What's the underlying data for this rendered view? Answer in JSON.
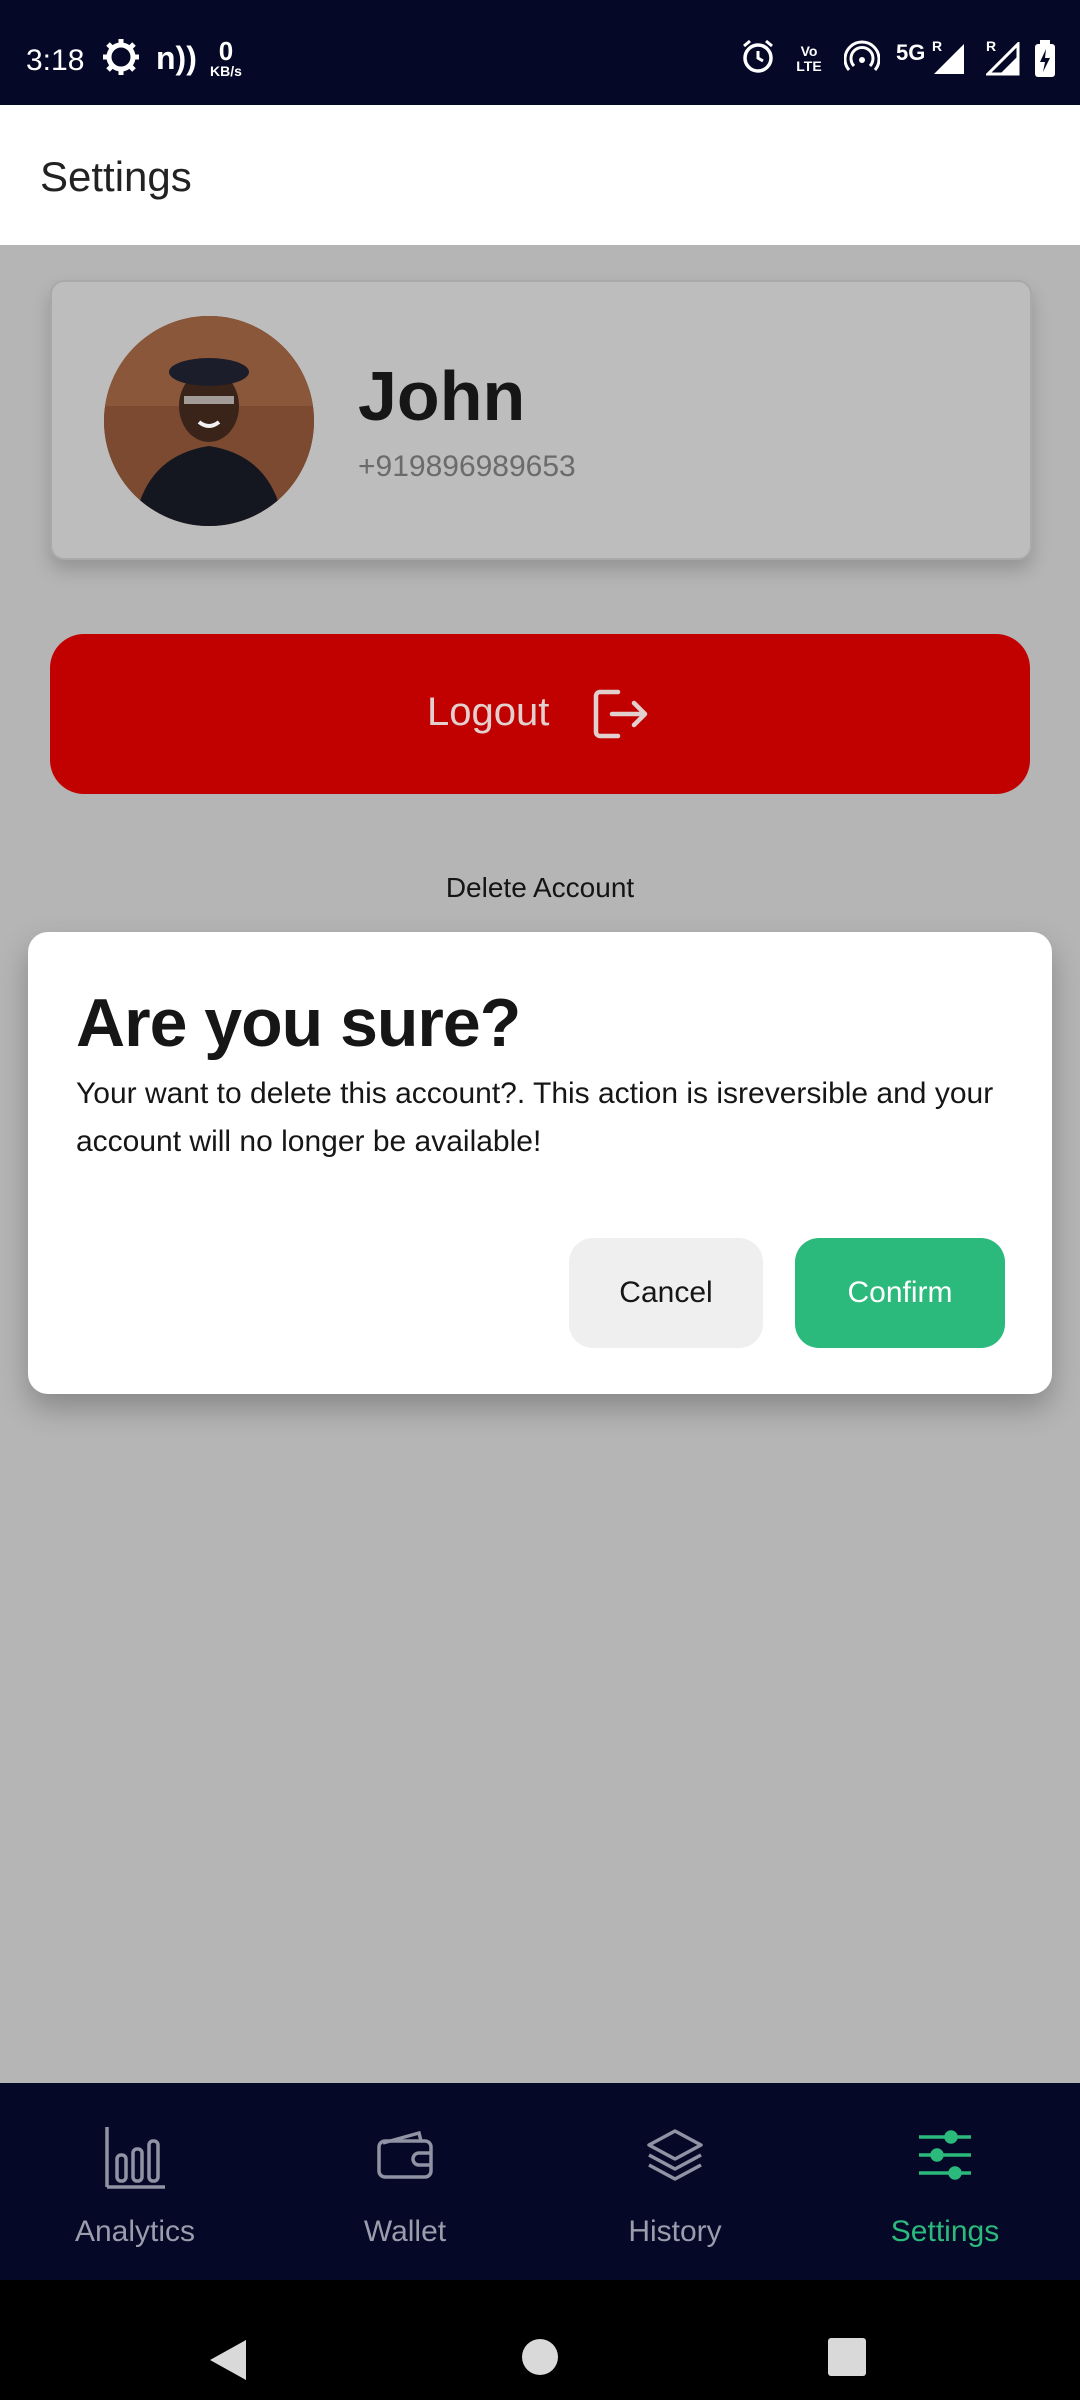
{
  "status_bar": {
    "time": "3:18",
    "speed_value": "0",
    "speed_unit": "KB/s",
    "network": "5G",
    "volte": "Vo LTE",
    "roaming": "R"
  },
  "app_bar": {
    "title": "Settings"
  },
  "profile": {
    "name": "John",
    "phone": "+919896989653"
  },
  "actions": {
    "logout_label": "Logout",
    "delete_account_label": "Delete Account"
  },
  "dialog": {
    "title": "Are you sure?",
    "message": "Your want to delete this account?. This action is isreversible and your account will no longer be available!",
    "cancel_label": "Cancel",
    "confirm_label": "Confirm"
  },
  "bottom_nav": {
    "items": [
      {
        "label": "Analytics",
        "icon": "bar-chart-icon"
      },
      {
        "label": "Wallet",
        "icon": "wallet-icon"
      },
      {
        "label": "History",
        "icon": "layers-icon"
      },
      {
        "label": "Settings",
        "icon": "sliders-icon",
        "active": true
      }
    ]
  },
  "colors": {
    "status_bar_bg": "#050826",
    "logout_red": "#c10000",
    "confirm_green": "#2bb97c",
    "scrim_gray": "#b5b5b5"
  }
}
